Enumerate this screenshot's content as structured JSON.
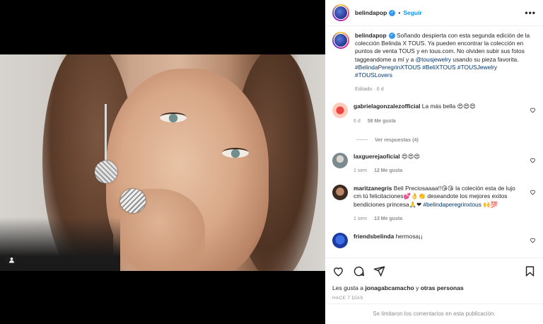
{
  "post": {
    "username": "belindapop",
    "follow_label": "Seguir",
    "dot": "•",
    "more": "•••"
  },
  "caption": {
    "username": "belindapop",
    "text_1": " Soñando despierta con esta segunda edición de la colección Belinda X TOUS. Ya pueden encontrar la colección en puntos de venta TOUS y en tous.com. No olviden subir sus fotos taggeandome a mí y a ",
    "mention": "@tousjewelry",
    "text_2": " usando su pieza favorita. ",
    "hashtags": "#BelindaPeregrinXTOUS #BeliXTOUS #TOUSJewelry #TOUSLovers",
    "meta": "Editado · 6 d"
  },
  "comments": [
    {
      "username": "gabrielagonzalezofficial",
      "text": " La más bella 😍😍😍",
      "time": "6 d",
      "likes": "58 Me gusta"
    },
    {
      "username": "laxguerejaoficial",
      "text": " 😍😍😍",
      "time": "1 sem",
      "likes": "12 Me gusta"
    },
    {
      "username": "maritzanegris",
      "text": " Beli Preciosaaaa!!😘😘 la coleción esta de lujo cm tú felicitaciones💕👌👏 deseandote los mejores exitos bendiciones princesa🙏❤ ",
      "tag": "#belindaperegrinxtous",
      "tail": " 🙌💯",
      "time": "1 sem",
      "likes": "13 Me gusta"
    },
    {
      "username": "friendsbelinda",
      "text": " hermosa¡¡"
    }
  ],
  "view_replies": "Ver respuestas (4)",
  "likes_line": {
    "prefix": "Les gusta a ",
    "user": "jonagabcamacho",
    "middle": " y ",
    "rest": "otras personas"
  },
  "time_ago": "HACE 7 DÍAS",
  "comments_closed": "Se limitaron los comentarios en esta publicación.",
  "icons": [
    "user-tag-icon",
    "more-icon",
    "heart-icon",
    "comment-icon",
    "share-icon",
    "save-icon",
    "verified-icon"
  ],
  "colors": {
    "link": "#00376b",
    "follow": "#0095f6",
    "muted": "#8e8e8e",
    "verified": "#3897f0"
  }
}
